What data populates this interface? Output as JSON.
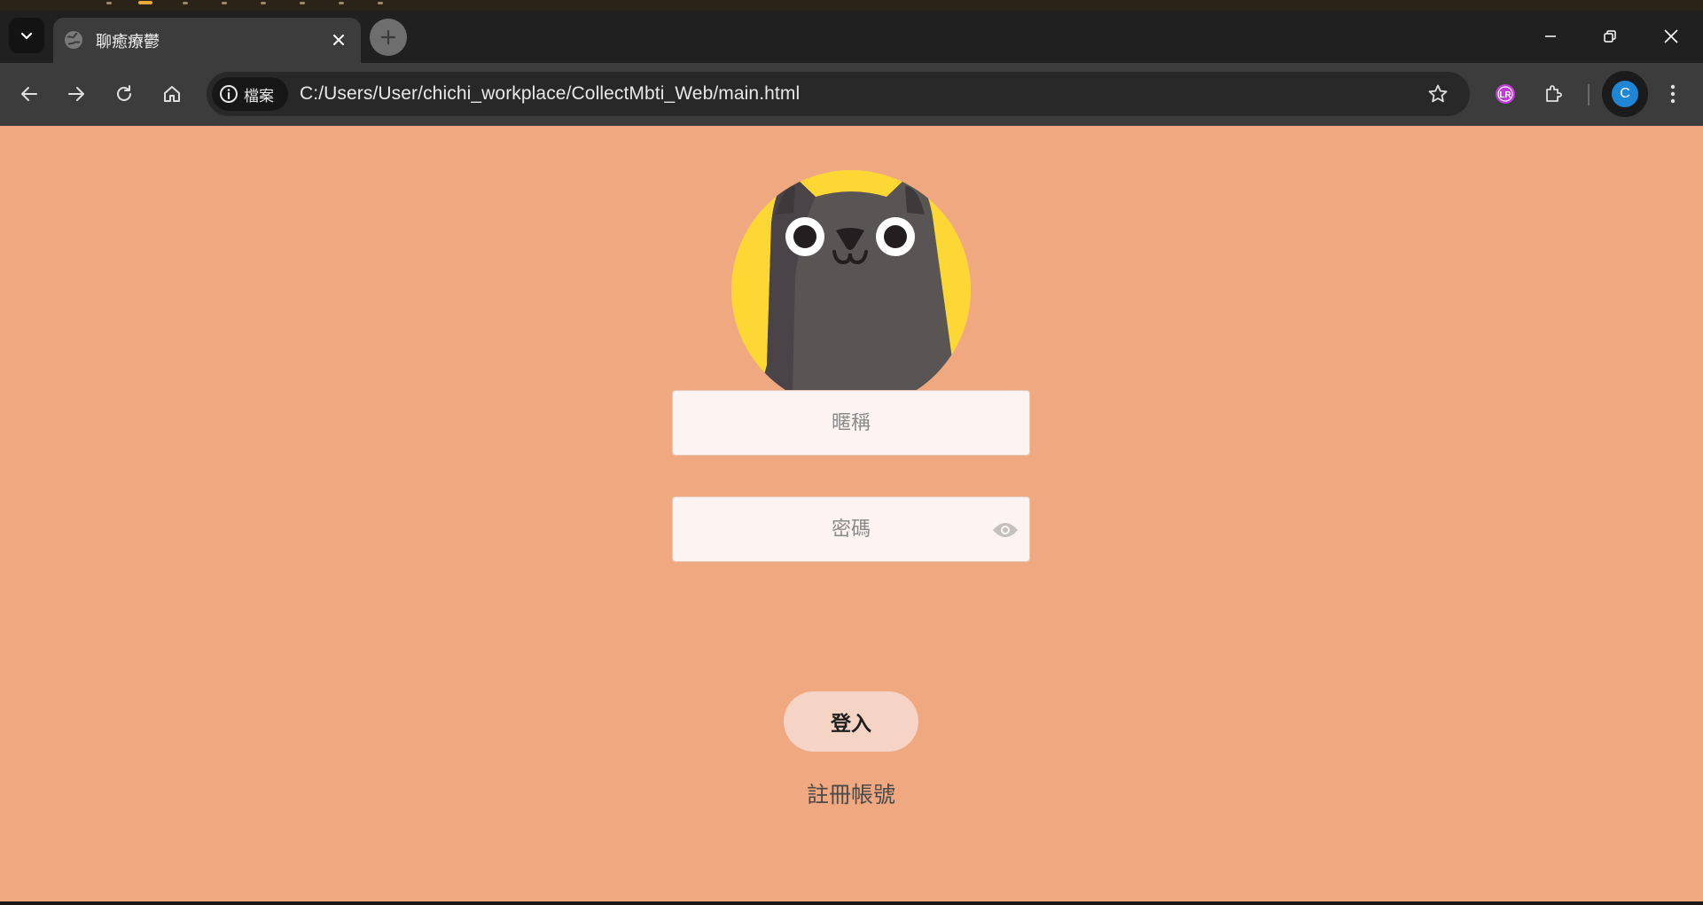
{
  "browser": {
    "tab": {
      "title": "聊癒療鬱"
    },
    "omnibox": {
      "chip_label": "檔案",
      "url": "C:/Users/User/chichi_workplace/CollectMbti_Web/main.html"
    },
    "profile_initial": "C",
    "extension_badge": "LR"
  },
  "page": {
    "background_color": "#f0a881",
    "avatar": {
      "icon": "cat-avatar-icon",
      "circle_color": "#fdd835",
      "cat_color": "#5a5555"
    },
    "nickname_field": {
      "placeholder": "暱稱",
      "value": ""
    },
    "password_field": {
      "placeholder": "密碼",
      "value": ""
    },
    "login_button": "登入",
    "register_link": "註冊帳號"
  }
}
